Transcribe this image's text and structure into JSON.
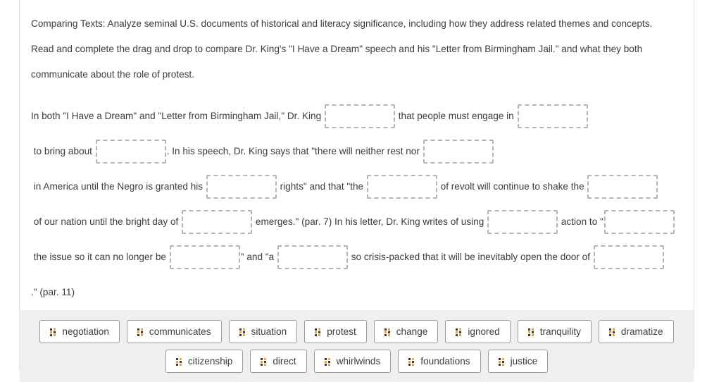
{
  "instructions": [
    "Comparing Texts: Analyze seminal U.S. documents of historical and literacy significance, including how they address related themes and concepts.",
    "Read and complete the drag and drop to compare Dr. King's \"I Have a Dream\" speech and his \"Letter from Birmingham Jail.\" and what they both",
    "communicate about the role of protest."
  ],
  "prompt_segments": [
    {
      "type": "text",
      "value": "In both \"I Have a Dream\" and \"Letter from Birmingham Jail,\" Dr. King "
    },
    {
      "type": "blank",
      "name": "blank-1",
      "width": 100
    },
    {
      "type": "text",
      "value": " that people must engage in "
    },
    {
      "type": "blank",
      "name": "blank-2",
      "width": 100
    },
    {
      "type": "text",
      "value": " to bring about "
    },
    {
      "type": "blank",
      "name": "blank-3",
      "width": 100
    },
    {
      "type": "text",
      "value": ". In his speech, Dr. King says that \"there will neither rest nor "
    },
    {
      "type": "blank",
      "name": "blank-4",
      "width": 100
    },
    {
      "type": "text",
      "value": " in America until the Negro is granted his "
    },
    {
      "type": "blank",
      "name": "blank-5",
      "width": 100
    },
    {
      "type": "text",
      "value": " rights\" and that \"the "
    },
    {
      "type": "blank",
      "name": "blank-6",
      "width": 100
    },
    {
      "type": "text",
      "value": " of revolt will continue to shake the "
    },
    {
      "type": "blank",
      "name": "blank-7",
      "width": 100
    },
    {
      "type": "text",
      "value": " of our nation until the bright day of "
    },
    {
      "type": "blank",
      "name": "blank-8",
      "width": 100
    },
    {
      "type": "text",
      "value": " emerges.\" (par. 7) In his letter, Dr. King writes of using "
    },
    {
      "type": "blank",
      "name": "blank-9",
      "width": 100
    },
    {
      "type": "text",
      "value": " action to \""
    },
    {
      "type": "blank",
      "name": "blank-10",
      "width": 100
    },
    {
      "type": "text",
      "value": " the issue so it can no longer be "
    },
    {
      "type": "blank",
      "name": "blank-11",
      "width": 100
    },
    {
      "type": "text",
      "value": "\" and \"a "
    },
    {
      "type": "blank",
      "name": "blank-12",
      "width": 100
    },
    {
      "type": "text",
      "value": " so crisis-packed that it will be inevitably open the door of "
    },
    {
      "type": "blank",
      "name": "blank-13",
      "width": 100
    },
    {
      "type": "text",
      "value": ".\" (par. 11)"
    }
  ],
  "word_bank": {
    "icon": "drag-handle-icon",
    "rows": [
      [
        {
          "label": "negotiation"
        },
        {
          "label": "communicates"
        },
        {
          "label": "situation"
        },
        {
          "label": "protest"
        },
        {
          "label": "change"
        },
        {
          "label": "ignored"
        },
        {
          "label": "tranquility"
        },
        {
          "label": "dramatize"
        }
      ],
      [
        {
          "label": "citizenship"
        },
        {
          "label": "direct"
        },
        {
          "label": "whirlwinds"
        },
        {
          "label": "foundations"
        },
        {
          "label": "justice"
        }
      ]
    ]
  },
  "colors": {
    "text": "#3c3c3c",
    "card_background": "#ffffff",
    "word_bank_background": "#efefef",
    "dropzone_border": "#b5b5b5",
    "chip_border": "#9a9a9a"
  }
}
